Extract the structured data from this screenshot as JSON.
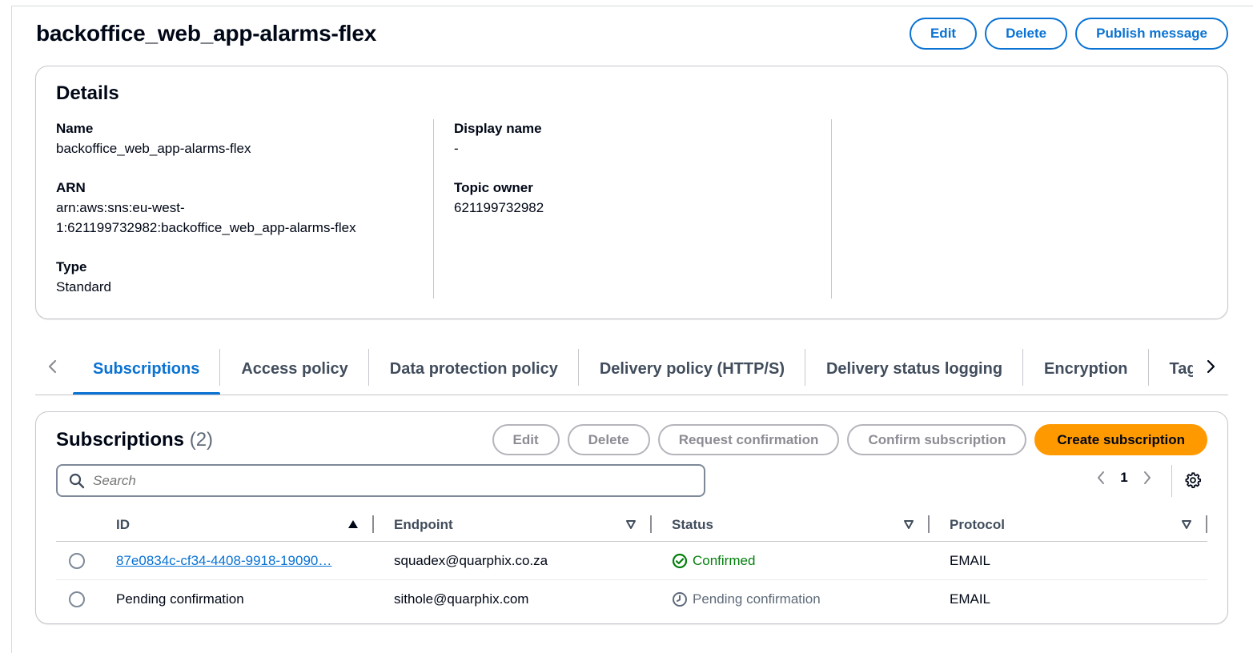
{
  "header": {
    "title": "backoffice_web_app-alarms-flex",
    "edit_label": "Edit",
    "delete_label": "Delete",
    "publish_label": "Publish message"
  },
  "details": {
    "title": "Details",
    "name_label": "Name",
    "name_value": "backoffice_web_app-alarms-flex",
    "arn_label": "ARN",
    "arn_line1": "arn:aws:sns:eu-west-",
    "arn_line2": "1:621199732982:backoffice_web_app-alarms-flex",
    "type_label": "Type",
    "type_value": "Standard",
    "display_name_label": "Display name",
    "display_name_value": "-",
    "owner_label": "Topic owner",
    "owner_value": "621199732982"
  },
  "tabs": [
    {
      "label": "Subscriptions",
      "active": true
    },
    {
      "label": "Access policy",
      "active": false
    },
    {
      "label": "Data protection policy",
      "active": false
    },
    {
      "label": "Delivery policy (HTTP/S)",
      "active": false
    },
    {
      "label": "Delivery status logging",
      "active": false
    },
    {
      "label": "Encryption",
      "active": false
    },
    {
      "label": "Tags",
      "active": false
    }
  ],
  "subscriptions": {
    "title": "Subscriptions",
    "count": "(2)",
    "edit_label": "Edit",
    "delete_label": "Delete",
    "request_label": "Request confirmation",
    "confirm_label": "Confirm subscription",
    "create_label": "Create subscription",
    "search_placeholder": "Search",
    "page": "1",
    "columns": {
      "id": "ID",
      "endpoint": "Endpoint",
      "status": "Status",
      "protocol": "Protocol"
    },
    "rows": [
      {
        "id": "87e0834c-cf34-4408-9918-19090…",
        "endpoint": "squadex@quarphix.co.za",
        "status": "Confirmed",
        "protocol": "EMAIL"
      },
      {
        "id": "Pending confirmation",
        "endpoint": "sithole@quarphix.com",
        "status": "Pending confirmation",
        "protocol": "EMAIL"
      }
    ]
  },
  "colors": {
    "accent": "#0972d3",
    "primary_button": "#ff9900",
    "success": "#037f0c",
    "muted": "#5f6b7a"
  },
  "icons": [
    "chevron-left-icon",
    "chevron-right-icon",
    "search-icon",
    "gear-icon",
    "sort-ascending-icon",
    "sort-icon",
    "check-circle-icon",
    "clock-icon"
  ]
}
